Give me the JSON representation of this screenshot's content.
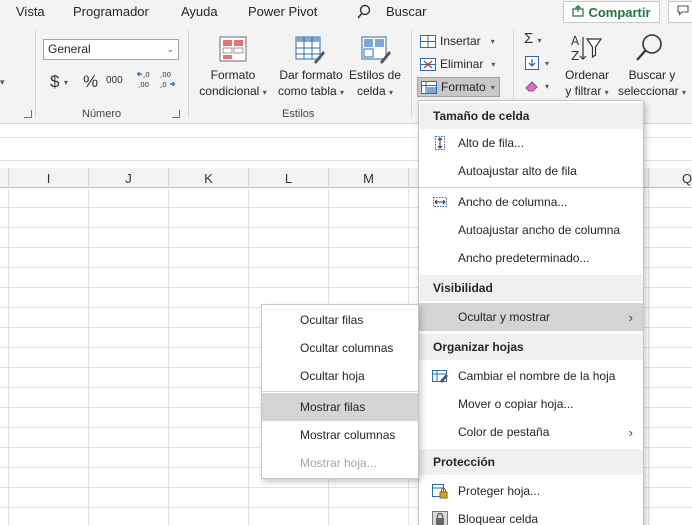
{
  "tabs": [
    "Vista",
    "Programador",
    "Ayuda",
    "Power Pivot"
  ],
  "search": {
    "label": "Buscar"
  },
  "share": {
    "label": "Compartir"
  },
  "number_group": {
    "format_value": "General",
    "currency_symbol": "$",
    "percent_symbol": "%",
    "thousands_symbol": "000",
    "label": "Número"
  },
  "styles_group": {
    "label": "Estilos",
    "conditional": [
      "Formato",
      "condicional"
    ],
    "as_table": [
      "Dar formato",
      "como tabla"
    ],
    "cell_styles": [
      "Estilos de",
      "celda"
    ]
  },
  "cells_group": {
    "insert": "Insertar",
    "delete": "Eliminar",
    "format": "Formato"
  },
  "editing_group": {
    "sort_filter": [
      "Ordenar",
      "y filtrar"
    ],
    "find_select": [
      "Buscar y",
      "seleccionar"
    ]
  },
  "columns": [
    "I",
    "J",
    "K",
    "L",
    "M",
    "Q"
  ],
  "format_menu": {
    "sections": {
      "cell_size": "Tamaño de celda",
      "visibility": "Visibilidad",
      "organize": "Organizar hojas",
      "protection": "Protección"
    },
    "items": {
      "row_height": "Alto de fila...",
      "autofit_row": "Autoajustar alto de fila",
      "col_width": "Ancho de columna...",
      "autofit_col": "Autoajustar ancho de columna",
      "default_width": "Ancho predeterminado...",
      "hide_unhide": "Ocultar y mostrar",
      "rename_sheet": "Cambiar el nombre de la hoja",
      "move_copy": "Mover o copiar hoja...",
      "tab_color": "Color de pestaña",
      "protect_sheet": "Proteger hoja...",
      "lock_cell": "Bloquear celda"
    }
  },
  "hide_submenu": {
    "items": [
      "Ocultar filas",
      "Ocultar columnas",
      "Ocultar hoja",
      "Mostrar filas",
      "Mostrar columnas",
      "Mostrar hoja..."
    ]
  },
  "colors": {
    "accent_green": "#217346",
    "highlight": "#d4d4d4",
    "section_bg": "#f0f0f0"
  }
}
